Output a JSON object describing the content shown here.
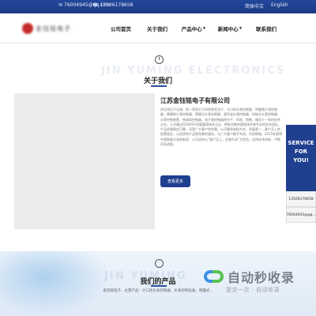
{
  "topbar": {
    "email": "76004945@qq.com",
    "phone": "13506178658",
    "lang_cn": "简体中文",
    "lang_en": "English"
  },
  "header": {
    "logo_text": "金钰铭电子"
  },
  "nav": [
    {
      "label": "公司首页"
    },
    {
      "label": "关于我们"
    },
    {
      "label": "产品中心"
    },
    {
      "label": "新闻中心"
    },
    {
      "label": "联系我们"
    }
  ],
  "about": {
    "watermark": "JIN YUMING ELECTRONICS",
    "title": "关于我们",
    "company": "江苏金钰铭电子有限公司",
    "description": "苏钰铭位于无锡，是一家致力于研发铁型芯片、大口径水表控制器、明露铁片表控制器、隔膜铁片表控制器、隔膜式水表控制器、超声波水表控制器、机械式水表控制器、水表控制装置、铁屑表控制器、电子表控制器的生产、研发、销售、服务于一体的综合企业。公司通过ISO9001质量管理体系认证，拥有完善的管理体系和专业的技术团队，产品质量稳定可靠，深受广大客户的信赖。公司秉承诚信为本、质量第一、客户至上的经营理念，以优质的产品和完善的服务，与广大客户携手共进，共创辉煌。2015年获得中国智能水表创新奖。公司坚持以“客户至上，信誉为本”为宗旨，坚持技术创新，不断开拓进取。",
    "more_button": "查看更多"
  },
  "side": {
    "service_line1": "SERVICE",
    "service_line2": "FOR YOU!",
    "phone": "13506178658",
    "qq": "76004945@qq..."
  },
  "products": {
    "watermark": "JIN YUMING",
    "title": "我们的产品",
    "description": "金钰铭电子、主营产品：大口径水表控制器、水表控制设备、明露式..."
  },
  "brand": {
    "name": "自动秒收录",
    "tagline": "提交一次 · 自动收录"
  }
}
